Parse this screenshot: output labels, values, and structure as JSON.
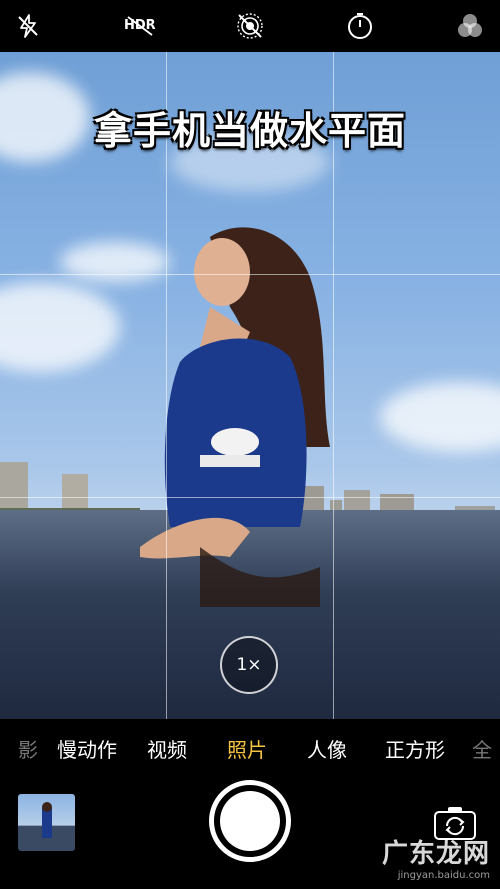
{
  "top_bar": {
    "icons": [
      "flash-off-icon",
      "hdr-off-icon",
      "live-photo-off-icon",
      "timer-icon",
      "filters-icon"
    ],
    "hdr_label": "HDR"
  },
  "viewfinder": {
    "caption": "拿手机当做水平面",
    "zoom_label": "1×"
  },
  "modes": {
    "items": [
      "影",
      "慢动作",
      "视频",
      "照片",
      "人像",
      "正方形",
      "全"
    ],
    "active": "照片"
  },
  "bottom": {
    "thumbnail_icon": "last-photo-thumbnail",
    "shutter_icon": "shutter-button",
    "flip_icon": "camera-flip-icon"
  },
  "watermark": {
    "main": "广东龙网",
    "url": "jingyan.baidu.com"
  },
  "colors": {
    "active_mode": "#f7c443",
    "background": "#000000"
  }
}
